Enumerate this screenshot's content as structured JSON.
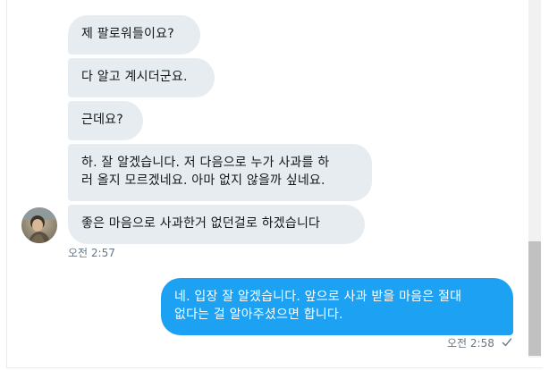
{
  "conversation": {
    "incoming": [
      {
        "text": "제 팔로워들이요?"
      },
      {
        "text": "다 알고 계시더군요."
      },
      {
        "text": "근데요?"
      },
      {
        "text": "하. 잘 알겠습니다. 저 다음으로 누가 사과를 하\n러 올지 모르겠네요. 아마 없지 않을까 싶네요."
      },
      {
        "text": "좋은 마음으로 사과한거 없던걸로 하겠습니다"
      }
    ],
    "incoming_time": "오전 2:57",
    "outgoing": [
      {
        "text": "네. 입장 잘 알겠습니다. 앞으로 사과 받을 마음은 절대\n없다는 걸 알아주셨으면 합니다."
      }
    ],
    "outgoing_time": "오전 2:58"
  },
  "colors": {
    "incoming_bubble": "#e6ecf0",
    "outgoing_bubble": "#1da1f2",
    "timestamp": "#657786"
  },
  "icons": {
    "avatar": "sender-avatar",
    "read_receipt": "checkmark-icon"
  }
}
